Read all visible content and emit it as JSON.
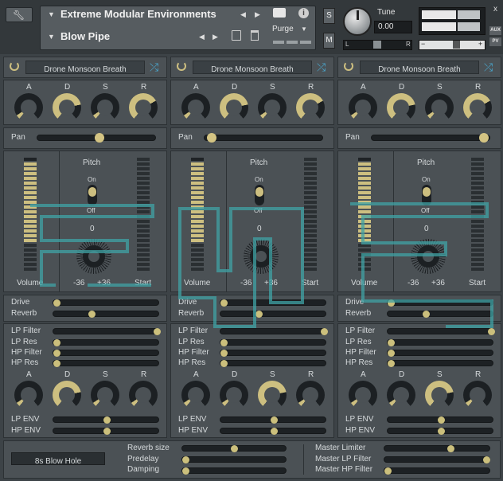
{
  "header": {
    "instrument_name": "Extreme Modular Environments",
    "preset_name": "Blow Pipe",
    "purge_label": "Purge",
    "tune_label": "Tune",
    "tune_value": "0.00",
    "solo_label": "S",
    "mute_label": "M",
    "pan_left": "L",
    "pan_right": "R",
    "vol_minus": "−",
    "vol_plus": "+",
    "aux_label": "AUX",
    "pv_label": "PV",
    "close_label": "x"
  },
  "channels": [
    {
      "sample": "Drone Monsoon Breath",
      "adsr_labels": [
        "A",
        "D",
        "S",
        "R"
      ],
      "pan_label": "Pan",
      "pan_value": 0.52,
      "pitch_label": "Pitch",
      "on_label": "On",
      "off_label": "Off",
      "pitch_value": "0",
      "pitch_min": "-36",
      "pitch_max": "+36",
      "volume_label": "Volume",
      "start_label": "Start",
      "drive_label": "Drive",
      "reverb_label": "Reverb",
      "lp_filter_label": "LP Filter",
      "lp_res_label": "LP Res",
      "hp_filter_label": "HP Filter",
      "hp_res_label": "HP Res",
      "lp_env_label": "LP ENV",
      "hp_env_label": "HP ENV",
      "env_labels": [
        "A",
        "D",
        "S",
        "R"
      ]
    },
    {
      "sample": "Drone Monsoon Breath",
      "adsr_labels": [
        "A",
        "D",
        "S",
        "R"
      ],
      "pan_label": "Pan",
      "pan_value": 0.02,
      "pitch_label": "Pitch",
      "on_label": "On",
      "off_label": "Off",
      "pitch_value": "0",
      "pitch_min": "-36",
      "pitch_max": "+36",
      "volume_label": "Volume",
      "start_label": "Start",
      "drive_label": "Drive",
      "reverb_label": "Reverb",
      "lp_filter_label": "LP Filter",
      "lp_res_label": "LP Res",
      "hp_filter_label": "HP Filter",
      "hp_res_label": "HP Res",
      "lp_env_label": "LP ENV",
      "hp_env_label": "HP ENV",
      "env_labels": [
        "A",
        "D",
        "S",
        "R"
      ]
    },
    {
      "sample": "Drone Monsoon Breath",
      "adsr_labels": [
        "A",
        "D",
        "S",
        "R"
      ],
      "pan_label": "Pan",
      "pan_value": 0.98,
      "pitch_label": "Pitch",
      "on_label": "On",
      "off_label": "Off",
      "pitch_value": "0",
      "pitch_min": "-36",
      "pitch_max": "+36",
      "volume_label": "Volume",
      "start_label": "Start",
      "drive_label": "Drive",
      "reverb_label": "Reverb",
      "lp_filter_label": "LP Filter",
      "lp_res_label": "LP Res",
      "hp_filter_label": "HP Filter",
      "hp_res_label": "HP Res",
      "lp_env_label": "LP ENV",
      "hp_env_label": "HP ENV",
      "env_labels": [
        "A",
        "D",
        "S",
        "R"
      ]
    }
  ],
  "footer": {
    "preset_button": "8s Blow Hole",
    "reverb_size_label": "Reverb size",
    "predelay_label": "Predelay",
    "damping_label": "Damping",
    "master_limiter_label": "Master Limiter",
    "master_lp_label": "Master LP Filter",
    "master_hp_label": "Master HP Filter"
  },
  "colors": {
    "accent": "#cdbf80",
    "logo": "#3fa3a5",
    "panel": "#4b5155",
    "background": "#3d4347"
  }
}
